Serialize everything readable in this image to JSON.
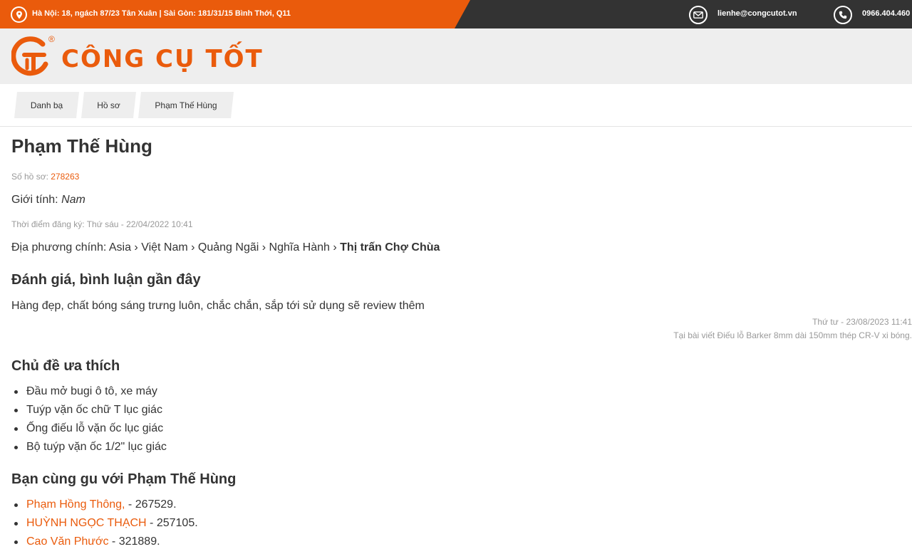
{
  "topbar": {
    "address": "Hà Nội: 18, ngách 87/23 Tân Xuân | Sài Gòn: 181/31/15 Bình Thới, Q11",
    "email": "lienhe@congcutot.vn",
    "phone": "0966.404.460"
  },
  "header": {
    "logo_text": "CÔNG CỤ TỐT",
    "registered_mark": "®"
  },
  "breadcrumb": [
    "Danh bạ",
    "Hồ sơ",
    "Phạm Thế Hùng"
  ],
  "profile": {
    "name": "Phạm Thế Hùng",
    "record_label": "Số hồ sơ:",
    "record_number": "278263",
    "gender_label": "Giới tính:",
    "gender_value": "Nam",
    "registered": "Thời điểm đăng ký: Thứ sáu - 22/04/2022 10:41",
    "region_label": "Địa phương chính:",
    "region_path": "Asia › Việt Nam › Quảng Ngãi › Nghĩa Hành ›",
    "region_final": "Thị trấn Chợ Chùa"
  },
  "reviews": {
    "heading": "Đánh giá, bình luận gần đây",
    "comment": "Hàng đẹp, chất bóng sáng trưng luôn, chắc chắn, sắp tới sử dụng sẽ review thêm",
    "date": "Thứ tư - 23/08/2023 11:41",
    "source": "Tại bài viết Điếu lỗ Barker 8mm dài 150mm thép CR-V xi bóng."
  },
  "topics": {
    "heading": "Chủ đề ưa thích",
    "items": [
      "Đầu mở bugi ô tô, xe máy",
      "Tuýp vặn ốc chữ T lục giác",
      "Ống điếu lỗ vặn ốc lục giác",
      "Bộ tuýp vặn ốc 1/2\" lục giác"
    ]
  },
  "friends": {
    "heading": "Bạn cùng gu với Phạm Thế Hùng",
    "items": [
      {
        "name": "Phạm Hồng Thông,",
        "suffix": " - 267529."
      },
      {
        "name": "HUỲNH NGỌC THẠCH",
        "suffix": " - 257105."
      },
      {
        "name": "Cao Văn Phước",
        "suffix": " - 321889."
      }
    ]
  },
  "colors": {
    "brand_orange": "#ea5b0c",
    "topbar_dark": "#333333",
    "header_bg": "#eeeeee"
  },
  "icons": {
    "address": "map-pin-icon",
    "email": "envelope-icon",
    "phone": "phone-icon",
    "logo": "ct-logo-icon"
  }
}
